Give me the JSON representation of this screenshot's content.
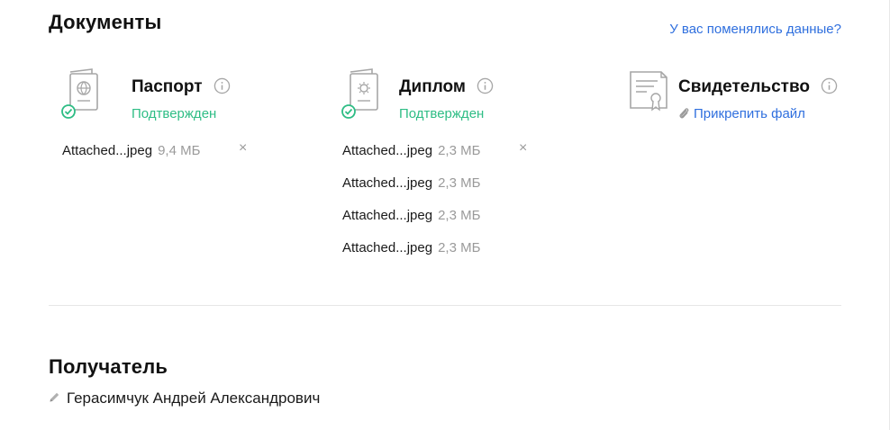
{
  "documents": {
    "title": "Документы",
    "changed_link": "У вас поменялись данные?",
    "items": [
      {
        "name": "Паспорт",
        "status": "Подтвержден",
        "icon": "passport-icon",
        "files": [
          {
            "name": "Attached...jpeg",
            "size": "9,4 МБ",
            "removable": true
          }
        ]
      },
      {
        "name": "Диплом",
        "status": "Подтвержден",
        "icon": "diploma-icon",
        "files": [
          {
            "name": "Attached...jpeg",
            "size": "2,3 МБ",
            "removable": true
          },
          {
            "name": "Attached...jpeg",
            "size": "2,3 МБ",
            "removable": false
          },
          {
            "name": "Attached...jpeg",
            "size": "2,3 МБ",
            "removable": false
          },
          {
            "name": "Attached...jpeg",
            "size": "2,3 МБ",
            "removable": false
          }
        ]
      },
      {
        "name": "Свидетельство",
        "attach_label": "Прикрепить файл",
        "icon": "certificate-icon",
        "files": []
      }
    ],
    "remove_symbol": "×"
  },
  "recipient": {
    "title": "Получатель",
    "name": "Герасимчук Андрей Александрович"
  },
  "colors": {
    "accent": "#2f6fde",
    "success": "#2ebd85",
    "muted": "#9a9a9a",
    "icon_stroke": "#a6a6a6"
  }
}
